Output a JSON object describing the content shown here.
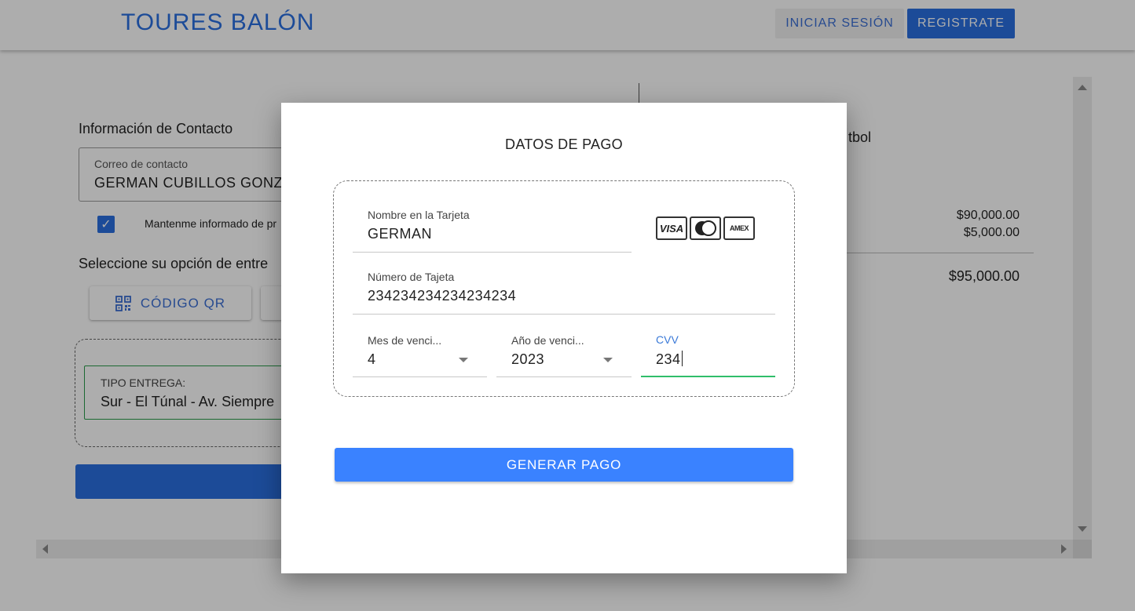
{
  "header": {
    "brand": "TOURES BALÓN",
    "login_label": "INICIAR SESIÓN",
    "register_label": "REGISTRATE"
  },
  "background": {
    "contact_title": "Información de Contacto",
    "email_label": "Correo de contacto",
    "email_value": "GERMAN CUBILLOS GONZ",
    "keep_informed": "Mantenme informado de pr",
    "delivery_title": "Seleccione su opción de entre",
    "qr_button_label": "CÓDIGO QR",
    "tipo_label": "TIPO ENTREGA:",
    "tipo_value": "Sur - El Túnal - Av. Siempre",
    "summary_text": "tbol",
    "price_line1": "$90,000.00",
    "price_line2": "$5,000.00",
    "total": "$95,000.00"
  },
  "modal": {
    "title": "DATOS DE PAGO",
    "name_label": "Nombre en la Tarjeta",
    "name_value": "GERMAN",
    "number_label": "Número de Tajeta",
    "number_value": "234234234234234234",
    "month_label": "Mes de venci...",
    "month_value": "4",
    "year_label": "Año de venci...",
    "year_value": "2023",
    "cvv_label": "CVV",
    "cvv_value": "234",
    "logos": {
      "visa": "VISA",
      "amex": "AMEX"
    },
    "pay_button": "GENERAR PAGO"
  },
  "colors": {
    "brand_blue": "#2a6fe0",
    "pay_button": "#3a82ff",
    "focus_green": "#2fbe6a"
  }
}
